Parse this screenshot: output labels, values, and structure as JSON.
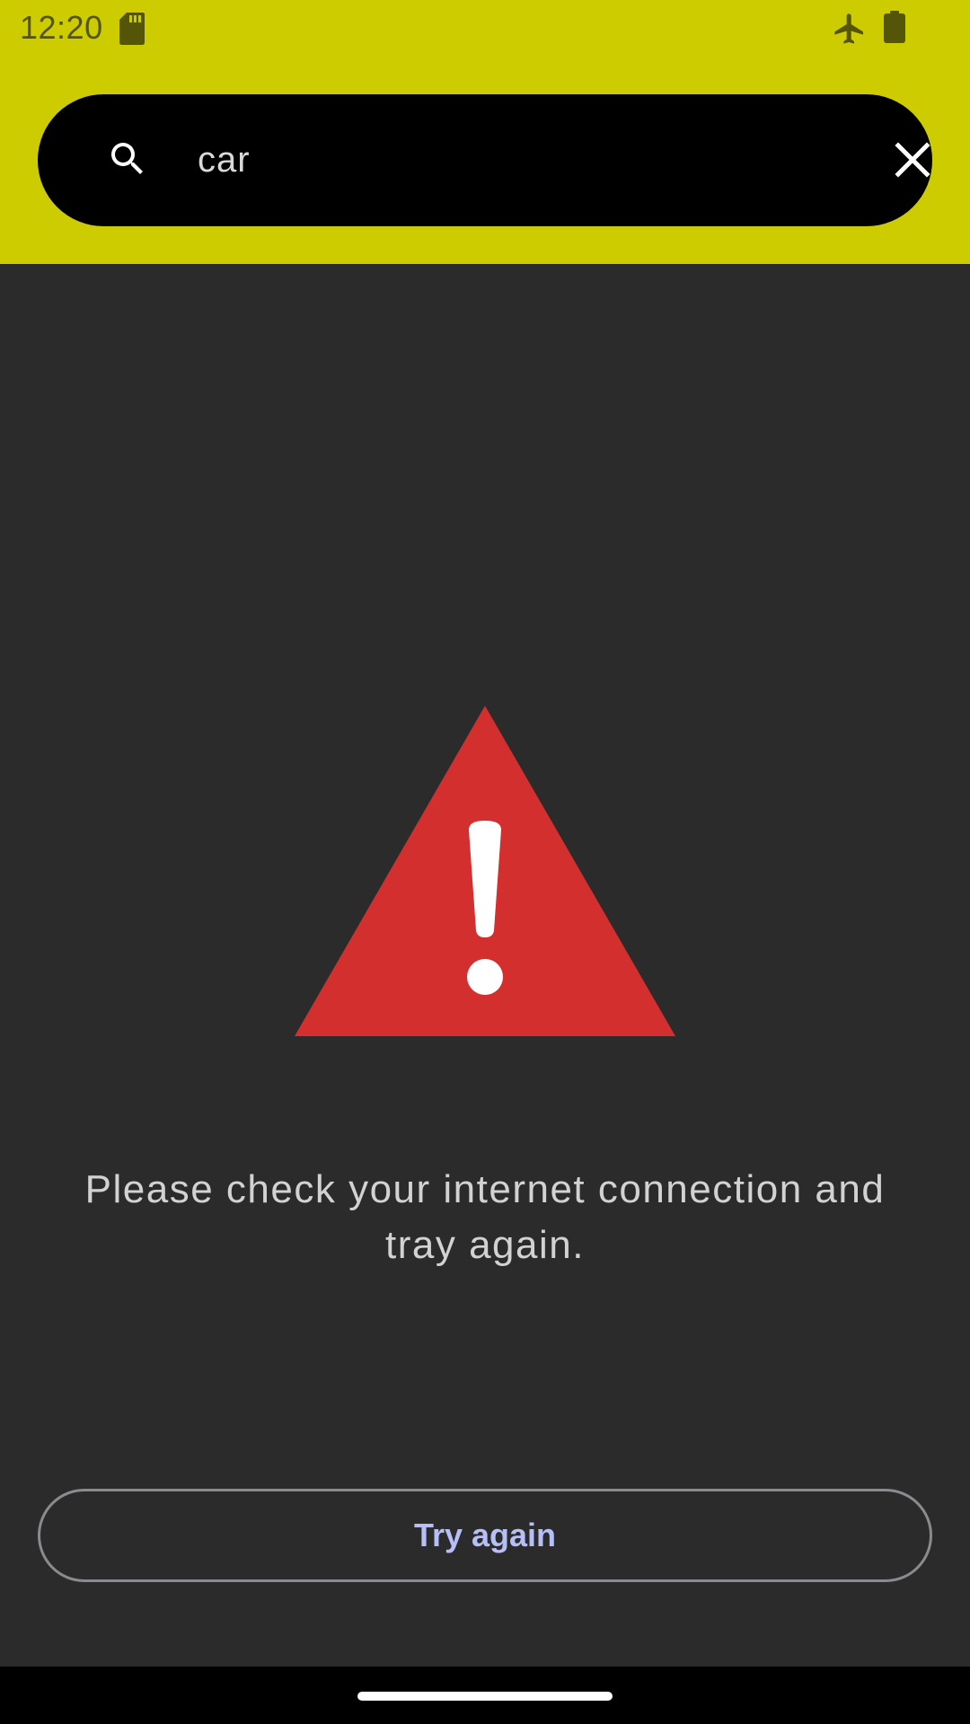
{
  "status_bar": {
    "time": "12:20",
    "icons": [
      "sd-card-icon",
      "airplane-mode-icon",
      "battery-icon"
    ],
    "color": "#cccc00"
  },
  "search": {
    "value": "car",
    "icon": "search-icon",
    "clear_icon": "close-icon"
  },
  "error": {
    "icon": "warning-icon",
    "icon_color": "#d32f2f",
    "message": "Please check your internet connection and tray again."
  },
  "actions": {
    "retry_label": "Try again",
    "retry_color": "#b7bff7"
  },
  "theme": {
    "accent": "#cccc00",
    "background": "#2b2b2c"
  }
}
